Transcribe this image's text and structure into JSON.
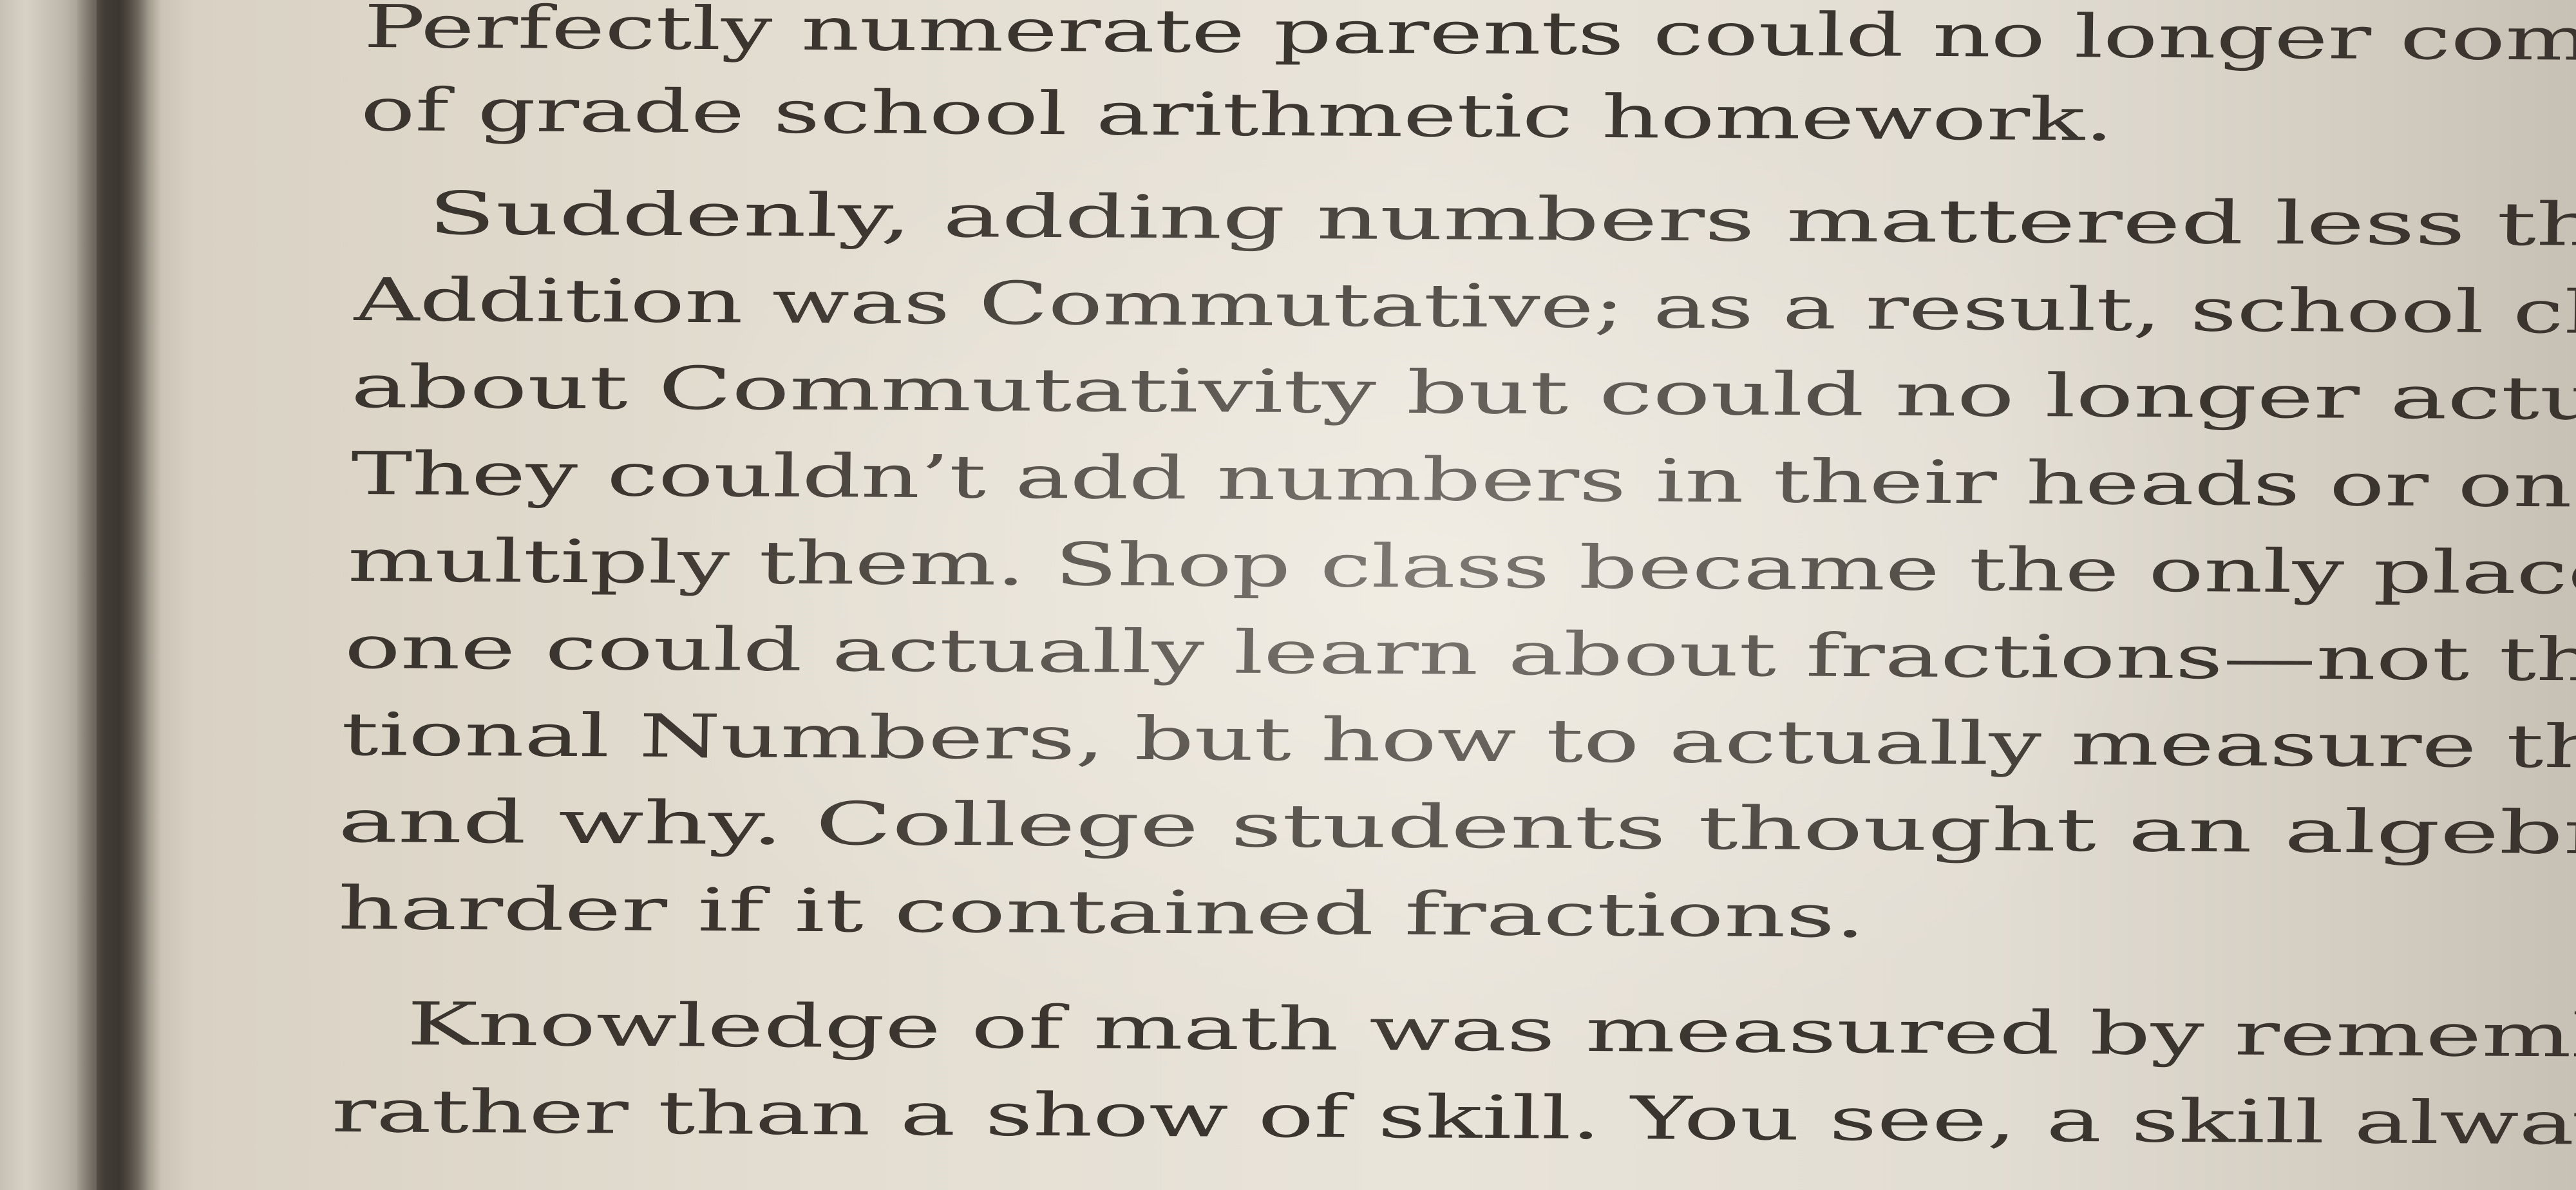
{
  "document": {
    "paragraph_1": {
      "lines": [
        "Perfectly numerate parents could no longer comprehend the point",
        "of grade school arithmetic homework."
      ]
    },
    "paragraph_2": {
      "lines": [
        "Suddenly, adding numbers mattered less than knowing that",
        "Addition was Commutative; as a result, school children learned",
        "about Commutativity but could no longer actually add numbers.",
        "They couldn’t add numbers in their heads or on paper, let alone",
        "multiply them. Shop class became the only place in school where",
        "one could actually learn about fractions—not that they were Ra-",
        "tional Numbers, but how to actually measure things with them,",
        "and why. College students thought an algebraic equation was",
        "harder if it contained fractions."
      ]
    },
    "paragraph_3": {
      "lines": [
        "Knowledge of math was measured by remembering special words,",
        "rather than a show of skill. You see, a skill always involves a lot"
      ]
    }
  }
}
